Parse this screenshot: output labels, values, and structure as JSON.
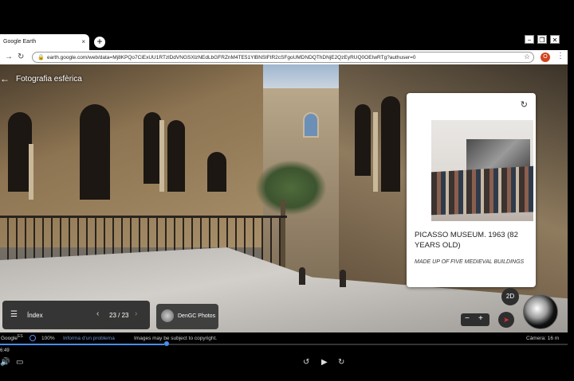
{
  "browser": {
    "tab_title": "Google Earth",
    "tab_close": "×",
    "new_tab": "+",
    "url": "earth.google.com/web/data=Mj8KPQo7CiExUU1RTzlDdVNGSXlzNEdLbGFRZnM4TE51YlBNSlFtR2cSFgoUMDNDQThDNjE2QzEyRUQ0OEIwRTg?authuser=0",
    "profile_initial": "O"
  },
  "window_controls": {
    "minimize": "−",
    "restore": "❐",
    "close": "✕"
  },
  "header": {
    "title": "Fotografia esfèrica"
  },
  "card": {
    "title": "PICASSO MUSEUM. 1963 (82 YEARS OLD)",
    "subtitle": "MADE UP OF FIVE MEDIEVAL BUILDINGS"
  },
  "index_panel": {
    "label": "Índex",
    "counter": "23 / 23"
  },
  "contributor": {
    "name": "DenGC Photos"
  },
  "map_controls": {
    "mode_2d": "2D",
    "zoom_out": "−",
    "zoom_in": "+"
  },
  "status": {
    "logo": "Google",
    "logo_suffix": "ES",
    "zoom_percent": "100%",
    "report_link": "Informa d'un problema",
    "copyright": "Images may be subject to copyright.",
    "camera": "Càmera: 16 m"
  },
  "video": {
    "time": "6:49",
    "progress": 0.29
  },
  "icons": [
    "back-arrow-icon",
    "refresh-icon",
    "list-icon",
    "chevron-left-icon",
    "chevron-right-icon",
    "compass-icon",
    "globe-icon",
    "lock-icon",
    "star-icon",
    "menu-icon",
    "play-icon",
    "rewind-icon",
    "forward-icon",
    "volume-icon",
    "captions-icon"
  ]
}
